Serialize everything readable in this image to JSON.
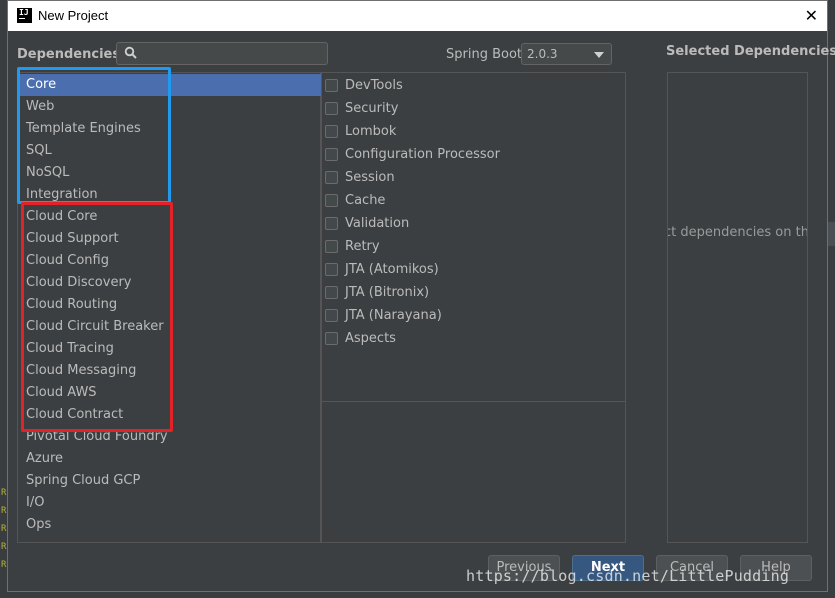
{
  "window": {
    "title": "New Project",
    "app_icon_text": "IJ"
  },
  "toolbar": {
    "dependencies_label": "Dependencies",
    "search": {
      "value": "",
      "placeholder": ""
    },
    "spring_boot_label": "Spring Boot",
    "spring_boot_version": "2.0.3"
  },
  "categories": [
    "Core",
    "Web",
    "Template Engines",
    "SQL",
    "NoSQL",
    "Integration",
    "Cloud Core",
    "Cloud Support",
    "Cloud Config",
    "Cloud Discovery",
    "Cloud Routing",
    "Cloud Circuit Breaker",
    "Cloud Tracing",
    "Cloud Messaging",
    "Cloud AWS",
    "Cloud Contract",
    "Pivotal Cloud Foundry",
    "Azure",
    "Spring Cloud GCP",
    "I/O",
    "Ops"
  ],
  "selected_category": "Core",
  "dependencies": [
    {
      "label": "DevTools",
      "checked": false
    },
    {
      "label": "Security",
      "checked": false
    },
    {
      "label": "Lombok",
      "checked": false
    },
    {
      "label": "Configuration Processor",
      "checked": false
    },
    {
      "label": "Session",
      "checked": false
    },
    {
      "label": "Cache",
      "checked": false
    },
    {
      "label": "Validation",
      "checked": false
    },
    {
      "label": "Retry",
      "checked": false
    },
    {
      "label": "JTA (Atomikos)",
      "checked": false
    },
    {
      "label": "JTA (Bitronix)",
      "checked": false
    },
    {
      "label": "JTA (Narayana)",
      "checked": false
    },
    {
      "label": "Aspects",
      "checked": false
    }
  ],
  "selected_dependencies": {
    "title": "Selected Dependencies",
    "hint": "ect dependencies on the"
  },
  "buttons": {
    "previous": "Previous",
    "next": "Next",
    "cancel": "Cancel",
    "help": "Help"
  },
  "annotations": {
    "blue_box_color": "#1e9bf0",
    "red_box_color": "#e32228"
  },
  "colors": {
    "selection": "#4b6eaf",
    "primary_button": "#365880",
    "panel_bg": "#3c3f41"
  },
  "watermark": "https://blog.csdn.net/LittlePudding"
}
